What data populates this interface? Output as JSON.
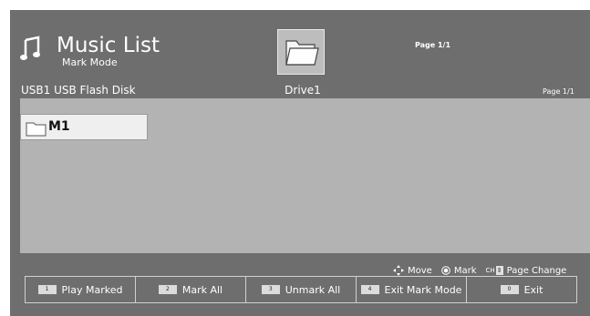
{
  "header": {
    "title": "Music List",
    "subtitle": "Mark Mode",
    "device": "USB1 USB Flash Disk",
    "drive_label": "Drive1",
    "page_top": "Page 1/1",
    "page_right": "Page 1/1"
  },
  "list": {
    "items": [
      {
        "label": "M1",
        "icon": "folder-icon"
      }
    ]
  },
  "hints": {
    "move": "Move",
    "mark": "Mark",
    "ch": "CH",
    "page_change": "Page Change"
  },
  "function_buttons": [
    {
      "number": "1",
      "label": "Play Marked"
    },
    {
      "number": "2",
      "label": "Mark All"
    },
    {
      "number": "3",
      "label": "Unmark All"
    },
    {
      "number": "4",
      "label": "Exit Mark Mode"
    },
    {
      "number": "0",
      "label": "Exit"
    }
  ],
  "colors": {
    "background": "#6e6e6e",
    "panel": "#b3b3b3",
    "selected_item": "#efefef"
  }
}
